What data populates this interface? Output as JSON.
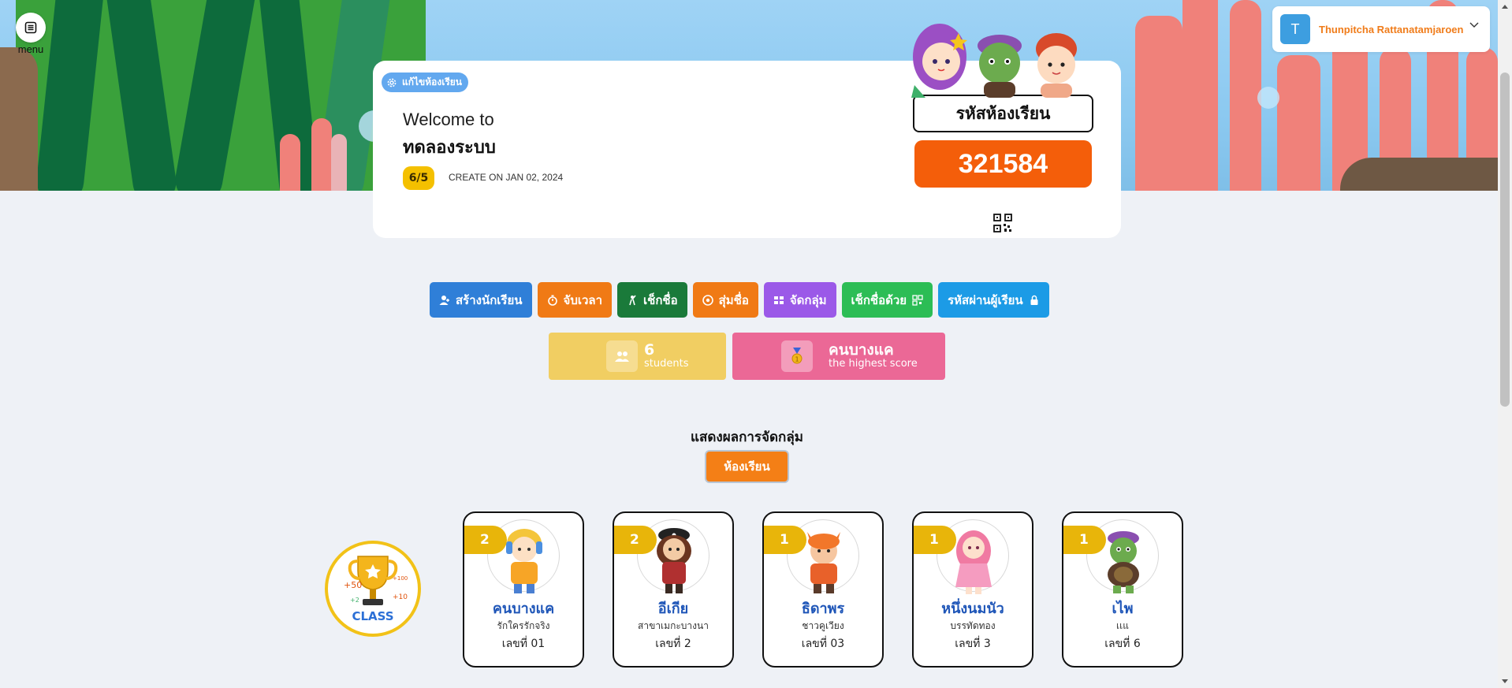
{
  "menu": {
    "label": "menu"
  },
  "user": {
    "initial": "T",
    "name": "Thunpitcha Rattanatamjaroen"
  },
  "classroom": {
    "edit_label": "แก้ไขห้องเรียน",
    "welcome": "Welcome to",
    "name": "ทดลองระบบ",
    "count_badge": "6/5",
    "created": "CREATE ON JAN 02, 2024",
    "code_label": "รหัสห้องเรียน",
    "code": "321584"
  },
  "actions": [
    {
      "label": "สร้างนักเรียน",
      "color": "#2f7fd8",
      "icon": "user-plus-icon"
    },
    {
      "label": "จับเวลา",
      "color": "#f07a15",
      "icon": "stopwatch-icon"
    },
    {
      "label": "เช็กชื่อ",
      "color": "#1a7a3a",
      "icon": "hand-raise-icon"
    },
    {
      "label": "สุ่มชื่อ",
      "color": "#f07a15",
      "icon": "dice-icon"
    },
    {
      "label": "จัดกลุ่ม",
      "color": "#9b59e8",
      "icon": "group-icon"
    },
    {
      "label": "เช็กชื่อด้วย",
      "color": "#2cbd55",
      "icon": "qr-icon"
    },
    {
      "label": "รหัสผ่านผู้เรียน",
      "color": "#1c9be6",
      "icon": "lock-icon"
    }
  ],
  "stats": {
    "students": {
      "value": "6",
      "label": "students",
      "color": "#f1ce62"
    },
    "highest": {
      "value": "คนบางแค",
      "label": "the highest score",
      "color": "#eb6896"
    }
  },
  "groups": {
    "title": "แสดงผลการจัดกลุ่ม",
    "tab": "ห้องเรียน"
  },
  "trophy": {
    "text": "CLASS",
    "p1": "+50",
    "p2": "+100",
    "p3": "+2",
    "p4": "+10"
  },
  "students": [
    {
      "points": "2",
      "name": "คนบางแค",
      "nickname": "รักใครรักจริง",
      "number": "เลขที่ 01",
      "avatar": "boy-yellow-icon"
    },
    {
      "points": "2",
      "name": "อีเกีย",
      "nickname": "สาขาเมกะบางนา",
      "number": "เลขที่ 2",
      "avatar": "pirate-girl-icon"
    },
    {
      "points": "1",
      "name": "ธิดาพร",
      "nickname": "ชาวคูเวียง",
      "number": "เลขที่ 03",
      "avatar": "fox-boy-icon"
    },
    {
      "points": "1",
      "name": "หนึ่งนมนัว",
      "nickname": "บรรทัดทอง",
      "number": "เลขที่ 3",
      "avatar": "pink-girl-icon"
    },
    {
      "points": "1",
      "name": "เไพ",
      "nickname": "เเแ",
      "number": "เลขที่ 6",
      "avatar": "turtle-icon"
    }
  ]
}
